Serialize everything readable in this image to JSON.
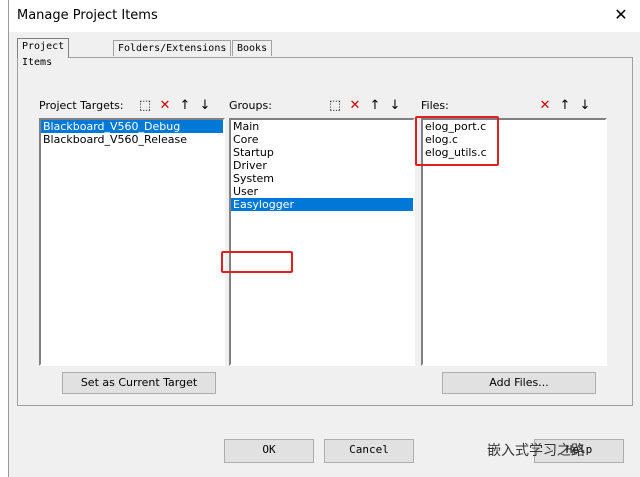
{
  "window": {
    "title": "Manage Project Items",
    "close_glyph": "✕"
  },
  "tabs": [
    {
      "label": "Project Items",
      "active": true
    },
    {
      "label": "Folders/Extensions",
      "active": false
    },
    {
      "label": "Books",
      "active": false
    }
  ],
  "targets": {
    "header": "Project Targets:",
    "items": [
      "Blackboard_V560_Debug",
      "Blackboard_V560_Release"
    ],
    "selected": 0,
    "button_label": "Set as Current Target"
  },
  "groups": {
    "header": "Groups:",
    "items": [
      "Main",
      "Core",
      "Startup",
      "Driver",
      "System",
      "User",
      "Easylogger"
    ],
    "selected": 6
  },
  "files": {
    "header": "Files:",
    "items": [
      "elog_port.c",
      "elog.c",
      "elog_utils.c"
    ],
    "button_label": "Add Files..."
  },
  "footer": {
    "ok": "OK",
    "cancel": "Cancel",
    "help": "Help"
  },
  "watermark": "嵌入式学习之路",
  "colors": {
    "selection": "#0078d7",
    "highlight_box": "#e02020"
  },
  "icons": [
    "new-item-icon",
    "delete-icon",
    "move-up-icon",
    "move-down-icon"
  ]
}
